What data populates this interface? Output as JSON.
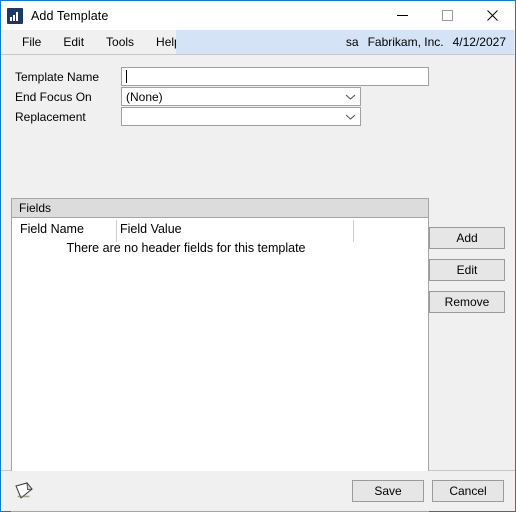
{
  "window": {
    "title": "Add Template",
    "app_icon": "bar-chart-icon",
    "accent_border": "#0a7cd4",
    "controls": {
      "minimize": "minimize-icon",
      "maximize": "maximize-icon",
      "close": "close-icon"
    }
  },
  "menubar": {
    "items": [
      {
        "label": "File"
      },
      {
        "label": "Edit"
      },
      {
        "label": "Tools"
      },
      {
        "label": "Help"
      }
    ],
    "status": {
      "user": "sa",
      "company": "Fabrikam, Inc.",
      "date": "4/12/2027",
      "background": "#d4e3f5"
    }
  },
  "form": {
    "template_name": {
      "label": "Template Name",
      "value": "",
      "placeholder": ""
    },
    "end_focus_on": {
      "label": "End Focus On",
      "value": "(None)",
      "chevron": "chevron-down-icon"
    },
    "replacement": {
      "label": "Replacement",
      "value": "",
      "chevron": "chevron-down-icon"
    }
  },
  "fields_group": {
    "header": "Fields",
    "columns": [
      {
        "key": "field_name",
        "label": "Field Name"
      },
      {
        "key": "field_value",
        "label": "Field Value"
      }
    ],
    "rows": [],
    "empty_message": "There are no header fields for this template"
  },
  "side_buttons": [
    {
      "label": "Add"
    },
    {
      "label": "Edit"
    },
    {
      "label": "Remove"
    }
  ],
  "footer": {
    "note_icon": "note-icon",
    "buttons": [
      {
        "label": "Save"
      },
      {
        "label": "Cancel"
      }
    ]
  }
}
